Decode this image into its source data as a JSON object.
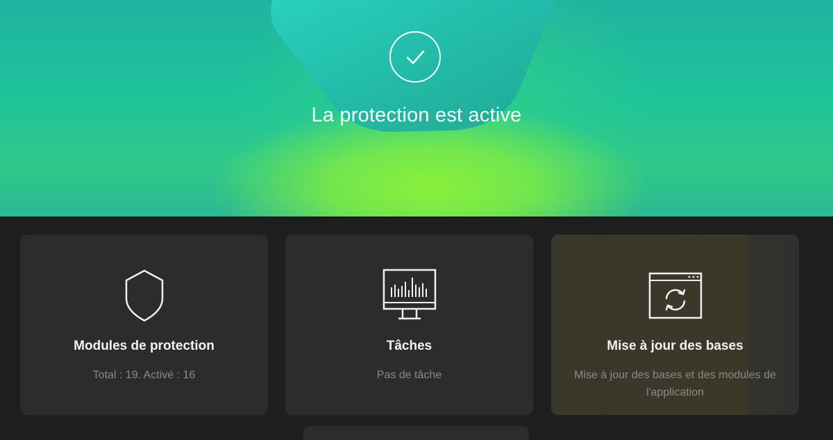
{
  "status": {
    "icon": "checkmark-circle-icon",
    "title": "La protection est active",
    "colors": {
      "hero_teal": "#1fb3a0",
      "hero_green": "#8af03a"
    }
  },
  "cards": [
    {
      "icon": "shield-icon",
      "title": "Modules de protection",
      "subtitle": "Total : 19. Activé : 16"
    },
    {
      "icon": "monitor-chart-icon",
      "title": "Tâches",
      "subtitle": "Pas de tâche"
    },
    {
      "icon": "update-refresh-icon",
      "title": "Mise à jour des bases",
      "subtitle": "Mise à jour des bases et des modules de l'application"
    }
  ]
}
